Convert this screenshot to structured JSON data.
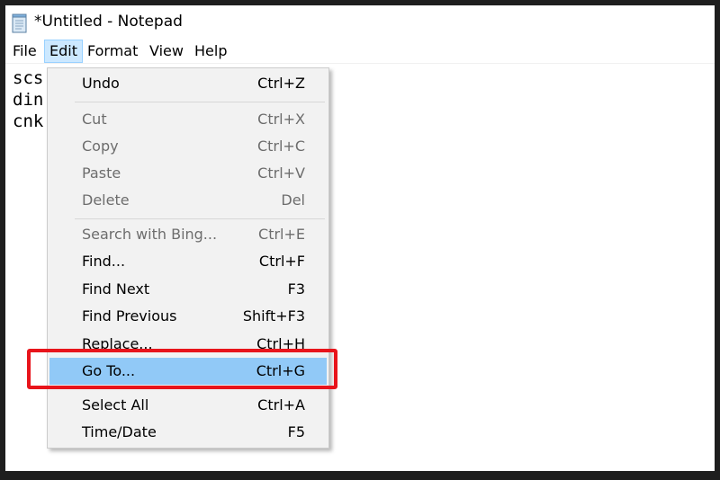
{
  "window": {
    "title": "*Untitled - Notepad",
    "icon": "notepad-icon"
  },
  "menubar": [
    "File",
    "Edit",
    "Format",
    "View",
    "Help"
  ],
  "editor": {
    "lines": [
      "scs",
      "din",
      "cnk"
    ]
  },
  "edit_menu": {
    "items": [
      {
        "label": "Undo",
        "shortcut": "Ctrl+Z",
        "enabled": true
      },
      {
        "label": "Cut",
        "shortcut": "Ctrl+X",
        "enabled": false
      },
      {
        "label": "Copy",
        "shortcut": "Ctrl+C",
        "enabled": false
      },
      {
        "label": "Paste",
        "shortcut": "Ctrl+V",
        "enabled": false
      },
      {
        "label": "Delete",
        "shortcut": "Del",
        "enabled": false
      },
      {
        "label": "Search with Bing...",
        "shortcut": "Ctrl+E",
        "enabled": false
      },
      {
        "label": "Find...",
        "shortcut": "Ctrl+F",
        "enabled": true
      },
      {
        "label": "Find Next",
        "shortcut": "F3",
        "enabled": true
      },
      {
        "label": "Find Previous",
        "shortcut": "Shift+F3",
        "enabled": true
      },
      {
        "label": "Replace...",
        "shortcut": "Ctrl+H",
        "enabled": true
      },
      {
        "label": "Go To...",
        "shortcut": "Ctrl+G",
        "enabled": true,
        "highlighted": true
      },
      {
        "label": "Select All",
        "shortcut": "Ctrl+A",
        "enabled": true
      },
      {
        "label": "Time/Date",
        "shortcut": "F5",
        "enabled": true
      }
    ]
  },
  "colors": {
    "menu_highlight": "#91c9f7",
    "annotation_border": "#e8141b",
    "active_menu_bg": "#cce8ff"
  }
}
